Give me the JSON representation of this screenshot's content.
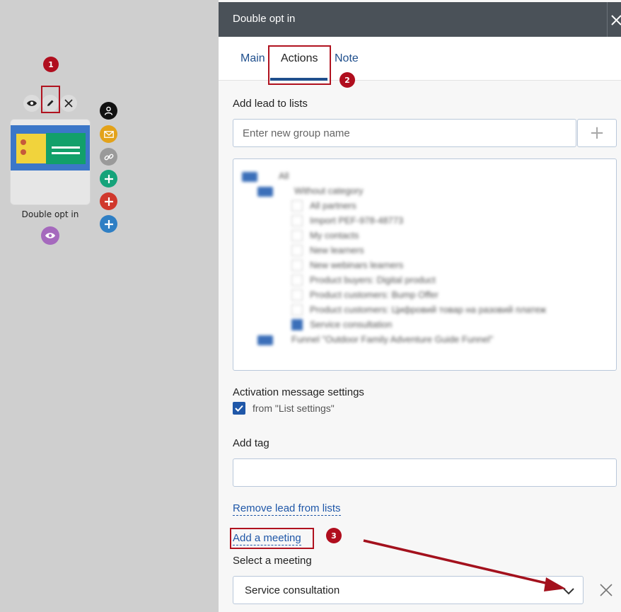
{
  "canvas": {
    "annotation_1": "1",
    "annotation_2": "2",
    "annotation_3": "3",
    "node_label": "Double opt in",
    "tools": {
      "preview_icon": "eye-icon",
      "edit_icon": "pencil-icon",
      "delete_icon": "close-icon"
    },
    "action_icons": [
      {
        "name": "user-icon",
        "color": "#111111"
      },
      {
        "name": "mail-icon",
        "color": "#e3a21a"
      },
      {
        "name": "link-icon",
        "color": "#9a9a9a"
      },
      {
        "name": "plus-icon",
        "color": "#15a37a"
      },
      {
        "name": "plus-icon",
        "color": "#d0382c"
      },
      {
        "name": "plus-icon",
        "color": "#2f7fc4"
      }
    ]
  },
  "panel": {
    "title": "Double opt in",
    "tabs": [
      {
        "label": "Main"
      },
      {
        "label": "Actions"
      },
      {
        "label": "Note"
      }
    ],
    "active_tab": "Actions",
    "add_lead_label": "Add lead to lists",
    "group_input_placeholder": "Enter new group name",
    "add_group_button": "+",
    "tree": {
      "root": "All",
      "folder": "Without category",
      "items": [
        "All partners",
        "Import PEF-978-48773",
        "My contacts",
        "New learners",
        "New webinars learners",
        "Product buyers: Digital product",
        "Product customers: Bump Offer",
        "Product customers: Цифровий товар на разовий платеж",
        "Service consultation"
      ],
      "second_folder": "Funnel \"Outdoor Family Adventure Guide Funnel\""
    },
    "activation_label": "Activation message settings",
    "activation_checkbox_label": "from \"List settings\"",
    "add_tag_label": "Add tag",
    "tag_input_value": "",
    "remove_lead_link": "Remove lead from lists",
    "add_meeting_link": "Add a meeting",
    "select_meeting_label": "Select a meeting",
    "meeting_value": "Service consultation"
  },
  "colors": {
    "header_bg": "#4a5158",
    "accent": "#1f57a8",
    "annotation": "#b0121f"
  }
}
